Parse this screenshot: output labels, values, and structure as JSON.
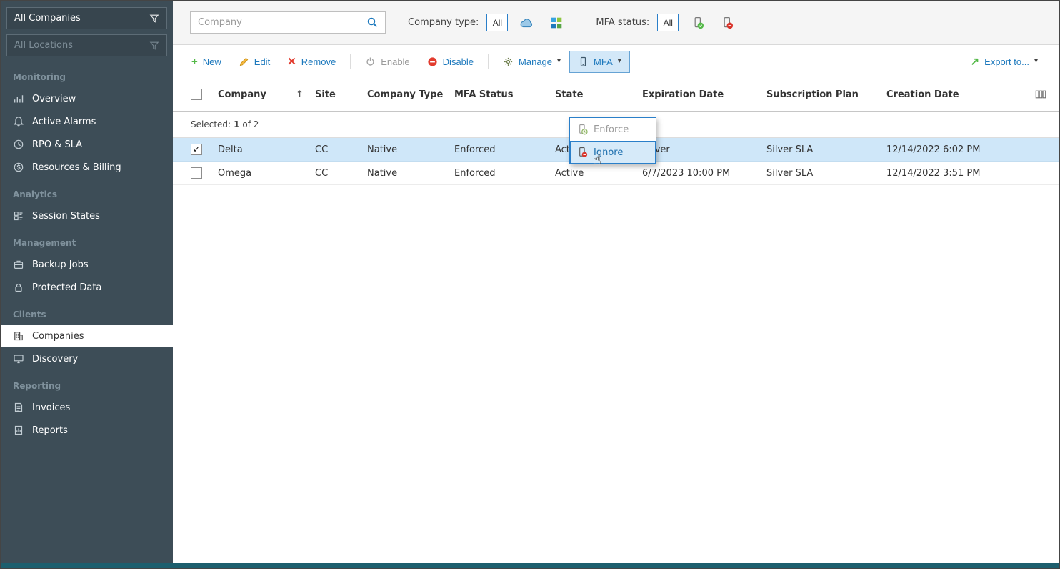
{
  "sidebar": {
    "company_filter": "All Companies",
    "location_filter": "All Locations",
    "sections": [
      {
        "label": "Monitoring",
        "items": [
          {
            "label": "Overview"
          },
          {
            "label": "Active Alarms"
          },
          {
            "label": "RPO & SLA"
          },
          {
            "label": "Resources & Billing"
          }
        ]
      },
      {
        "label": "Analytics",
        "items": [
          {
            "label": "Session States"
          }
        ]
      },
      {
        "label": "Management",
        "items": [
          {
            "label": "Backup Jobs"
          },
          {
            "label": "Protected Data"
          }
        ]
      },
      {
        "label": "Clients",
        "items": [
          {
            "label": "Companies"
          },
          {
            "label": "Discovery"
          }
        ]
      },
      {
        "label": "Reporting",
        "items": [
          {
            "label": "Invoices"
          },
          {
            "label": "Reports"
          }
        ]
      }
    ]
  },
  "filterbar": {
    "search_placeholder": "Company",
    "company_type_label": "Company type:",
    "company_type_value": "All",
    "mfa_status_label": "MFA status:",
    "mfa_status_value": "All"
  },
  "toolbar": {
    "new": "New",
    "edit": "Edit",
    "remove": "Remove",
    "enable": "Enable",
    "disable": "Disable",
    "manage": "Manage",
    "mfa": "MFA",
    "export": "Export to..."
  },
  "mfa_menu": {
    "enforce": "Enforce",
    "ignore": "Ignore"
  },
  "table": {
    "selected_prefix": "Selected:",
    "selected_count": "1",
    "selected_suffix": "of 2",
    "columns": {
      "company": "Company",
      "site": "Site",
      "company_type": "Company Type",
      "mfa_status": "MFA Status",
      "state": "State",
      "expiration_date": "Expiration Date",
      "subscription_plan": "Subscription Plan",
      "creation_date": "Creation Date"
    },
    "rows": [
      {
        "company": "Delta",
        "site": "CC",
        "company_type": "Native",
        "mfa_status": "Enforced",
        "state": "Active",
        "expiration_date": "Never",
        "subscription_plan": "Silver SLA",
        "creation_date": "12/14/2022 6:02 PM"
      },
      {
        "company": "Omega",
        "site": "CC",
        "company_type": "Native",
        "mfa_status": "Enforced",
        "state": "Active",
        "expiration_date": "6/7/2023 10:00 PM",
        "subscription_plan": "Silver SLA",
        "creation_date": "12/14/2022 3:51 PM"
      }
    ]
  },
  "glyphs": {
    "caret": "▾",
    "sort_asc": "↑",
    "plus": "+",
    "cross": "✕",
    "export_arrow": "↗",
    "cursor": "☝",
    "check": "✓"
  },
  "colors": {
    "accent": "#1d79bd",
    "green": "#54b948",
    "red": "#d9342b",
    "selected_row": "#cfe7f9",
    "sidebar": "#3d4d57"
  }
}
